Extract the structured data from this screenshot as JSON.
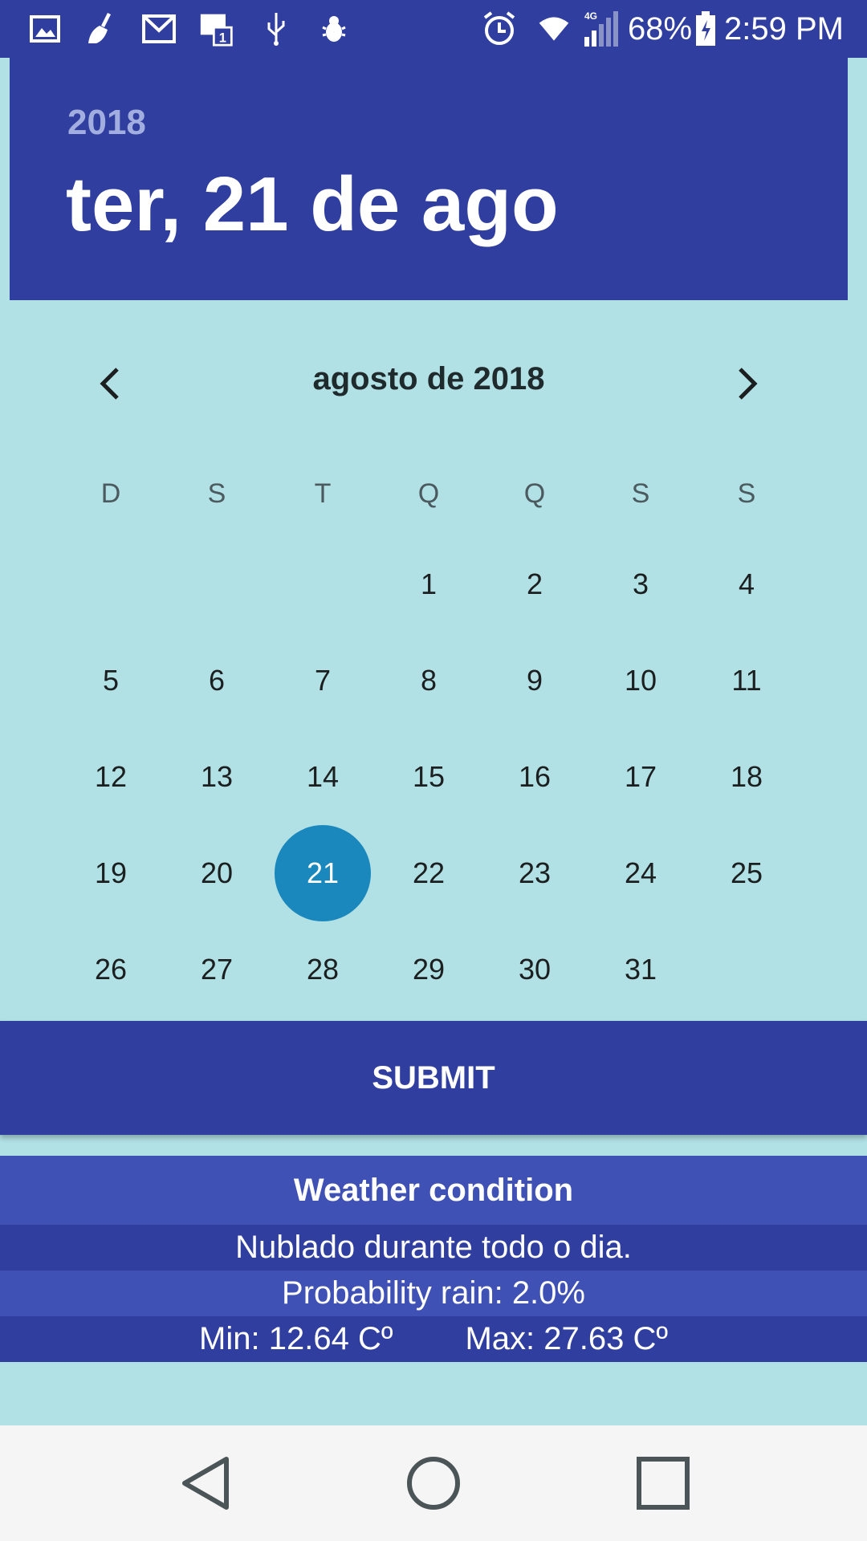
{
  "status_bar": {
    "battery_percent": "68%",
    "time": "2:59 PM",
    "network": "4G",
    "icons": [
      "gallery-icon",
      "broom-icon",
      "gmail-icon",
      "notification-badge-icon",
      "usb-icon",
      "bug-icon",
      "alarm-icon",
      "wifi-icon",
      "signal-icon",
      "battery-icon"
    ],
    "notification_count": "1"
  },
  "header": {
    "year": "2018",
    "date": "ter, 21 de ago"
  },
  "calendar": {
    "month_title": "agosto de 2018",
    "weekdays": [
      "D",
      "S",
      "T",
      "Q",
      "Q",
      "S",
      "S"
    ],
    "weeks": [
      [
        "",
        "",
        "",
        "1",
        "2",
        "3",
        "4"
      ],
      [
        "5",
        "6",
        "7",
        "8",
        "9",
        "10",
        "11"
      ],
      [
        "12",
        "13",
        "14",
        "15",
        "16",
        "17",
        "18"
      ],
      [
        "19",
        "20",
        "21",
        "22",
        "23",
        "24",
        "25"
      ],
      [
        "26",
        "27",
        "28",
        "29",
        "30",
        "31",
        ""
      ]
    ],
    "selected_day": "21",
    "accent_color": "#1a88bc"
  },
  "submit_label": "SUBMIT",
  "weather": {
    "title": "Weather condition",
    "summary": "Nublado durante todo o dia.",
    "probability": "Probability rain: 2.0%",
    "min": "Min: 12.64 Cº",
    "max": "Max: 27.63 Cº"
  },
  "colors": {
    "primary": "#303f9f",
    "primary_light": "#3f51b5",
    "background": "#b1e0e5"
  }
}
